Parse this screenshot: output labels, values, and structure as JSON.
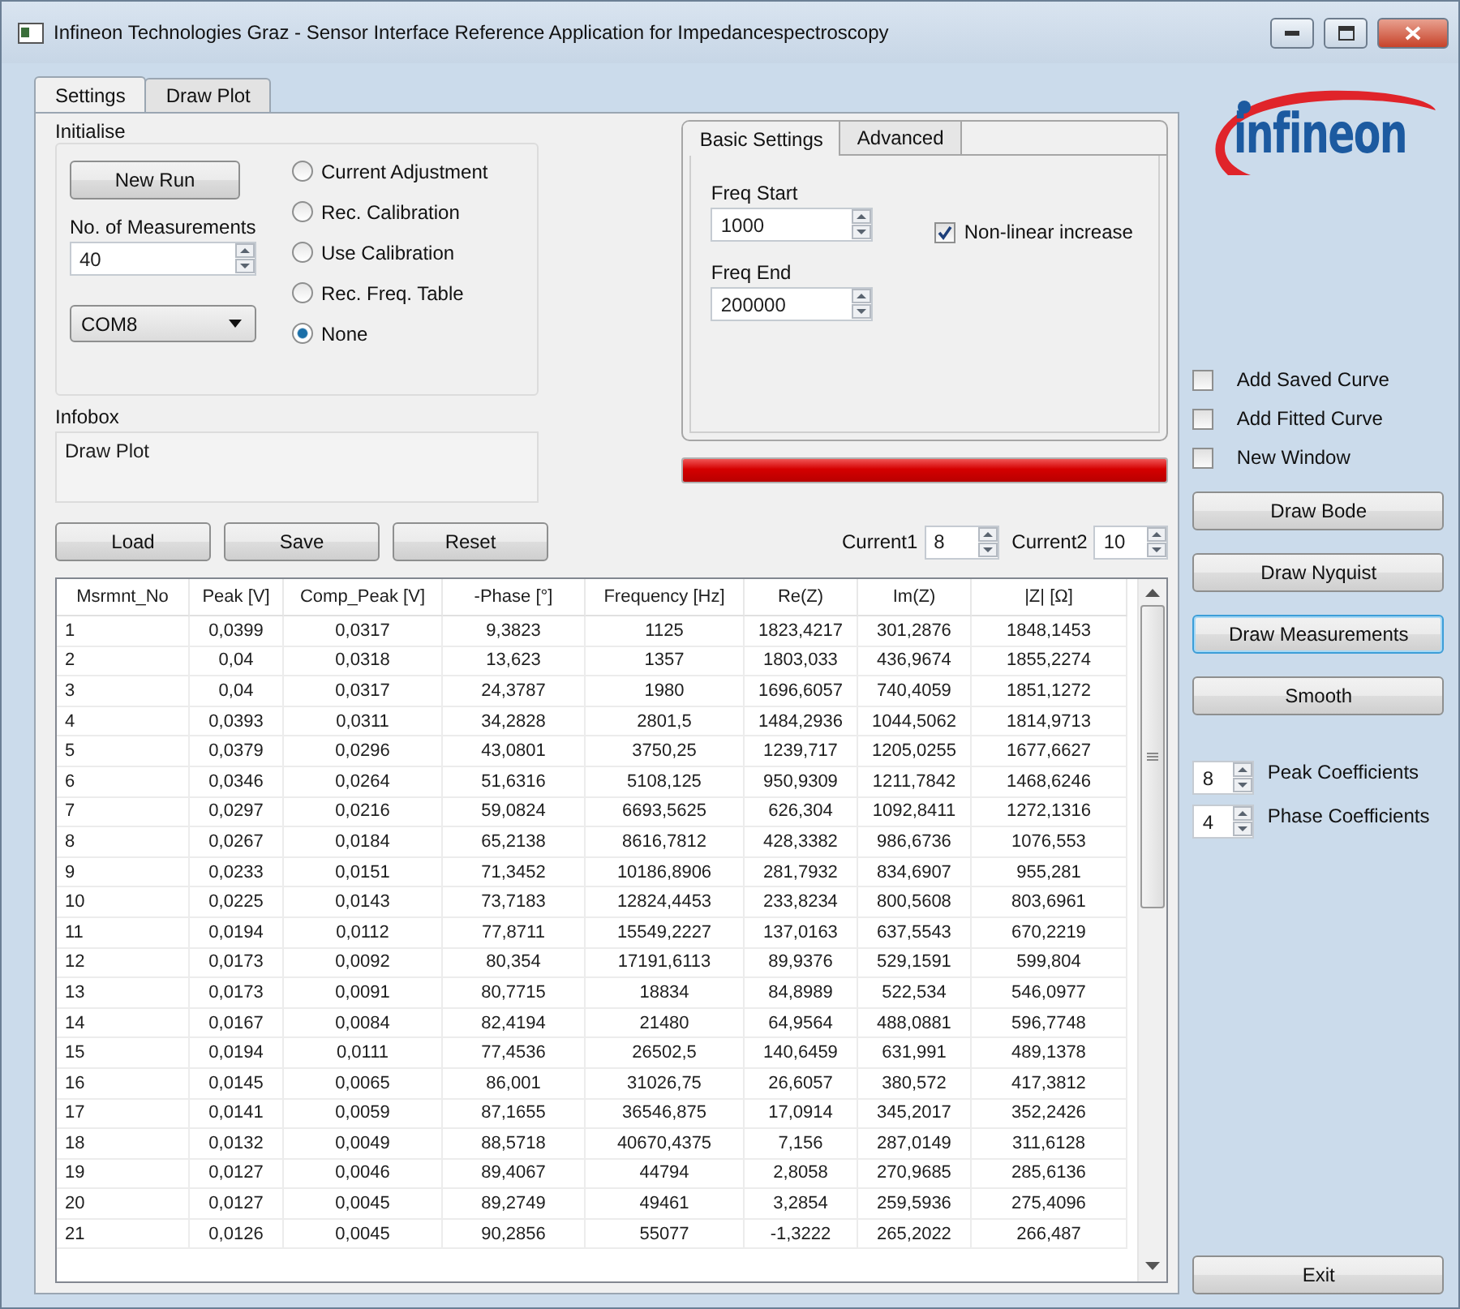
{
  "window": {
    "title": "Infineon Technologies Graz - Sensor Interface Reference Application for Impedancespectroscopy"
  },
  "tabs": [
    {
      "label": "Settings",
      "selected": true
    },
    {
      "label": "Draw Plot",
      "selected": false
    }
  ],
  "initialise": {
    "title": "Initialise",
    "new_run": "New Run",
    "measurements_label": "No. of Measurements",
    "measurements": "40",
    "port": "COM8",
    "modes": [
      {
        "label": "Current Adjustment",
        "selected": false
      },
      {
        "label": "Rec. Calibration",
        "selected": false
      },
      {
        "label": "Use Calibration",
        "selected": false
      },
      {
        "label": "Rec. Freq. Table",
        "selected": false
      },
      {
        "label": "None",
        "selected": true
      }
    ]
  },
  "infobox": {
    "title": "Infobox",
    "text": "Draw Plot"
  },
  "settings_tabs": [
    {
      "label": "Basic Settings",
      "selected": true
    },
    {
      "label": "Advanced",
      "selected": false
    }
  ],
  "basic": {
    "freq_start_label": "Freq Start",
    "freq_start": "1000",
    "freq_end_label": "Freq End",
    "freq_end": "200000",
    "nonlinear": {
      "label": "Non-linear increase",
      "checked": true
    }
  },
  "progress": {
    "level": 1
  },
  "actions": [
    "Load",
    "Save",
    "Reset"
  ],
  "currents": [
    {
      "label": "Current1",
      "value": "8"
    },
    {
      "label": "Current2",
      "value": "10"
    }
  ],
  "table": {
    "columns": [
      "Msrmnt_No",
      "Peak [V]",
      "Comp_Peak [V]",
      "-Phase [°]",
      "Frequency [Hz]",
      "Re(Z)",
      "Im(Z)",
      "|Z| [Ω]"
    ],
    "rows": [
      [
        "1",
        "0,0399",
        "0,0317",
        "9,3823",
        "1125",
        "1823,4217",
        "301,2876",
        "1848,1453"
      ],
      [
        "2",
        "0,04",
        "0,0318",
        "13,623",
        "1357",
        "1803,033",
        "436,9674",
        "1855,2274"
      ],
      [
        "3",
        "0,04",
        "0,0317",
        "24,3787",
        "1980",
        "1696,6057",
        "740,4059",
        "1851,1272"
      ],
      [
        "4",
        "0,0393",
        "0,0311",
        "34,2828",
        "2801,5",
        "1484,2936",
        "1044,5062",
        "1814,9713"
      ],
      [
        "5",
        "0,0379",
        "0,0296",
        "43,0801",
        "3750,25",
        "1239,717",
        "1205,0255",
        "1677,6627"
      ],
      [
        "6",
        "0,0346",
        "0,0264",
        "51,6316",
        "5108,125",
        "950,9309",
        "1211,7842",
        "1468,6246"
      ],
      [
        "7",
        "0,0297",
        "0,0216",
        "59,0824",
        "6693,5625",
        "626,304",
        "1092,8411",
        "1272,1316"
      ],
      [
        "8",
        "0,0267",
        "0,0184",
        "65,2138",
        "8616,7812",
        "428,3382",
        "986,6736",
        "1076,553"
      ],
      [
        "9",
        "0,0233",
        "0,0151",
        "71,3452",
        "10186,8906",
        "281,7932",
        "834,6907",
        "955,281"
      ],
      [
        "10",
        "0,0225",
        "0,0143",
        "73,7183",
        "12824,4453",
        "233,8234",
        "800,5608",
        "803,6961"
      ],
      [
        "11",
        "0,0194",
        "0,0112",
        "77,8711",
        "15549,2227",
        "137,0163",
        "637,5543",
        "670,2219"
      ],
      [
        "12",
        "0,0173",
        "0,0092",
        "80,354",
        "17191,6113",
        "89,9376",
        "529,1591",
        "599,804"
      ],
      [
        "13",
        "0,0173",
        "0,0091",
        "80,7715",
        "18834",
        "84,8989",
        "522,534",
        "546,0977"
      ],
      [
        "14",
        "0,0167",
        "0,0084",
        "82,4194",
        "21480",
        "64,9564",
        "488,0881",
        "596,7748"
      ],
      [
        "15",
        "0,0194",
        "0,0111",
        "77,4536",
        "26502,5",
        "140,6459",
        "631,991",
        "489,1378"
      ],
      [
        "16",
        "0,0145",
        "0,0065",
        "86,001",
        "31026,75",
        "26,6057",
        "380,572",
        "417,3812"
      ],
      [
        "17",
        "0,0141",
        "0,0059",
        "87,1655",
        "36546,875",
        "17,0914",
        "345,2017",
        "352,2426"
      ],
      [
        "18",
        "0,0132",
        "0,0049",
        "88,5718",
        "40670,4375",
        "7,156",
        "287,0149",
        "311,6128"
      ],
      [
        "19",
        "0,0127",
        "0,0046",
        "89,4067",
        "44794",
        "2,8058",
        "270,9685",
        "285,6136"
      ],
      [
        "20",
        "0,0127",
        "0,0045",
        "89,2749",
        "49461",
        "3,2854",
        "259,5936",
        "275,4096"
      ],
      [
        "21",
        "0,0126",
        "0,0045",
        "90,2856",
        "55077",
        "-1,3222",
        "265,2022",
        "266,487"
      ]
    ]
  },
  "logo": {
    "text": "infineon"
  },
  "plot_options": [
    {
      "label": "Add Saved Curve",
      "checked": false
    },
    {
      "label": "Add Fitted Curve",
      "checked": false
    },
    {
      "label": "New Window",
      "checked": false
    }
  ],
  "draw_buttons": [
    {
      "label": "Draw Bode",
      "selected": false
    },
    {
      "label": "Draw Nyquist",
      "selected": false
    },
    {
      "label": "Draw Measurements",
      "selected": true
    },
    {
      "label": "Smooth",
      "selected": false
    }
  ],
  "coefficients": [
    {
      "label": "Peak Coefficients",
      "value": "8"
    },
    {
      "label": "Phase Coefficients",
      "value": "4"
    }
  ],
  "exit": "Exit"
}
